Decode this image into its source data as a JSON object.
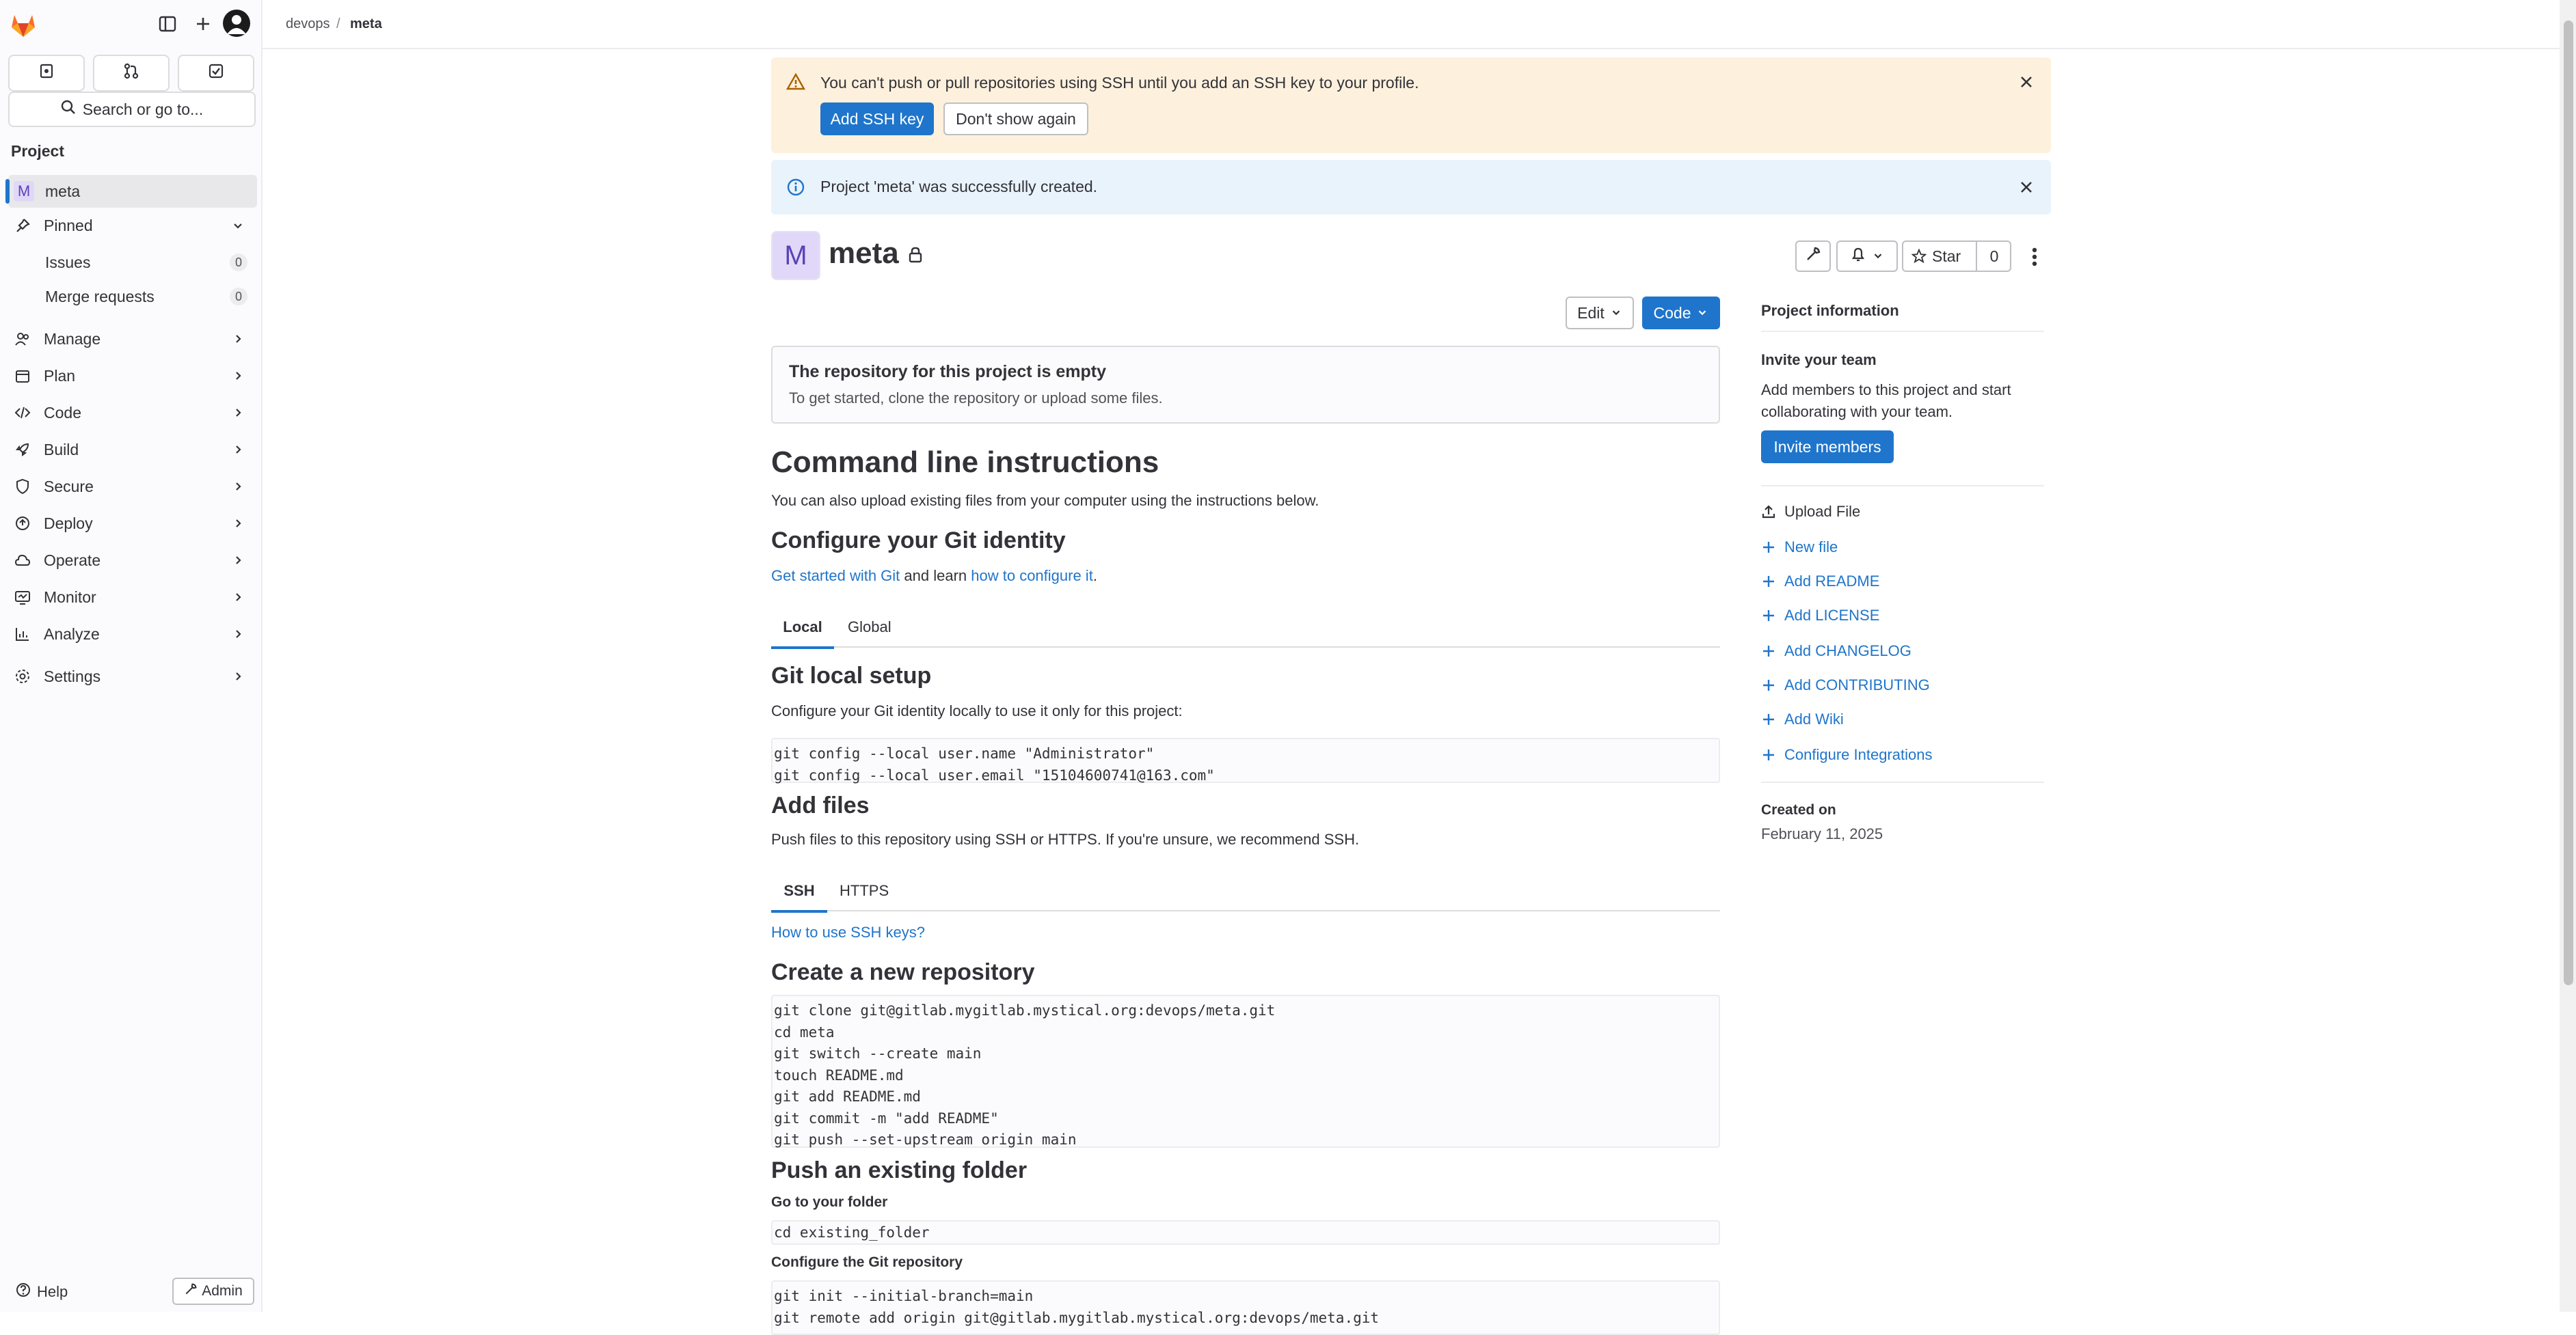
{
  "sidebar": {
    "top_buttons": [
      "issues-icon",
      "merge-request-icon",
      "todo-icon"
    ],
    "search": "Search or go to...",
    "heading": "Project",
    "project": {
      "letter": "M",
      "label": "meta"
    },
    "pinned": {
      "label": "Pinned",
      "items": [
        {
          "label": "Issues",
          "count": "0"
        },
        {
          "label": "Merge requests",
          "count": "0"
        }
      ]
    },
    "items": [
      {
        "label": "Manage"
      },
      {
        "label": "Plan"
      },
      {
        "label": "Code"
      },
      {
        "label": "Build"
      },
      {
        "label": "Secure"
      },
      {
        "label": "Deploy"
      },
      {
        "label": "Operate"
      },
      {
        "label": "Monitor"
      },
      {
        "label": "Analyze"
      }
    ],
    "settings": "Settings",
    "help": "Help",
    "admin": "Admin"
  },
  "breadcrumb": {
    "group": "devops",
    "sep": "/",
    "project": "meta"
  },
  "ssh_alert": {
    "message": "You can't push or pull repositories using SSH until you add an SSH key to your profile.",
    "primary": "Add SSH key",
    "secondary": "Don't show again"
  },
  "success_alert": {
    "message": "Project 'meta' was successfully created."
  },
  "project": {
    "avatar_letter": "M",
    "name": "meta",
    "star_label": "Star",
    "star_count": "0",
    "edit_label": "Edit",
    "code_label": "Code"
  },
  "empty_repo": {
    "title": "The repository for this project is empty",
    "text": "To get started, clone the repository or upload some files."
  },
  "cli": {
    "title": "Command line instructions",
    "intro": "You can also upload existing files from your computer using the instructions below.",
    "git_identity": {
      "title": "Configure your Git identity",
      "link1": "Get started with Git",
      "mid": " and learn ",
      "link2": "how to configure it",
      "end": ".",
      "tabs": [
        "Local",
        "Global"
      ]
    },
    "local_setup": {
      "title": "Git local setup",
      "text": "Configure your Git identity locally to use it only for this project:",
      "code": "git config --local user.name \"Administrator\"\ngit config --local user.email \"15104600741@163.com\""
    },
    "add_files": {
      "title": "Add files",
      "text": "Push files to this repository using SSH or HTTPS. If you're unsure, we recommend SSH.",
      "tabs": [
        "SSH",
        "HTTPS"
      ],
      "ssh_link": "How to use SSH keys?"
    },
    "new_repo": {
      "title": "Create a new repository",
      "code": "git clone git@gitlab.mygitlab.mystical.org:devops/meta.git\ncd meta\ngit switch --create main\ntouch README.md\ngit add README.md\ngit commit -m \"add README\"\ngit push --set-upstream origin main"
    },
    "push_folder": {
      "title": "Push an existing folder",
      "go_label": "Go to your folder",
      "go_code": "cd existing_folder",
      "configure_label": "Configure the Git repository",
      "configure_code": "git init --initial-branch=main\ngit remote add origin git@gitlab.mygitlab.mystical.org:devops/meta.git"
    }
  },
  "project_info": {
    "title": "Project information",
    "invite_title": "Invite your team",
    "invite_text_1": "Add members to this project and start",
    "invite_text_2": "collaborating with your team.",
    "invite_button": "Invite members",
    "upload": "Upload File",
    "links": [
      "New file",
      "Add README",
      "Add LICENSE",
      "Add CHANGELOG",
      "Add CONTRIBUTING",
      "Add Wiki",
      "Configure Integrations"
    ],
    "created_label": "Created on",
    "created_date": "February 11, 2025"
  },
  "colors": {
    "accent": "#1f75cb",
    "warning_bg": "#fdf1dd",
    "info_bg": "#e9f3fc",
    "brand": "#e24329"
  }
}
